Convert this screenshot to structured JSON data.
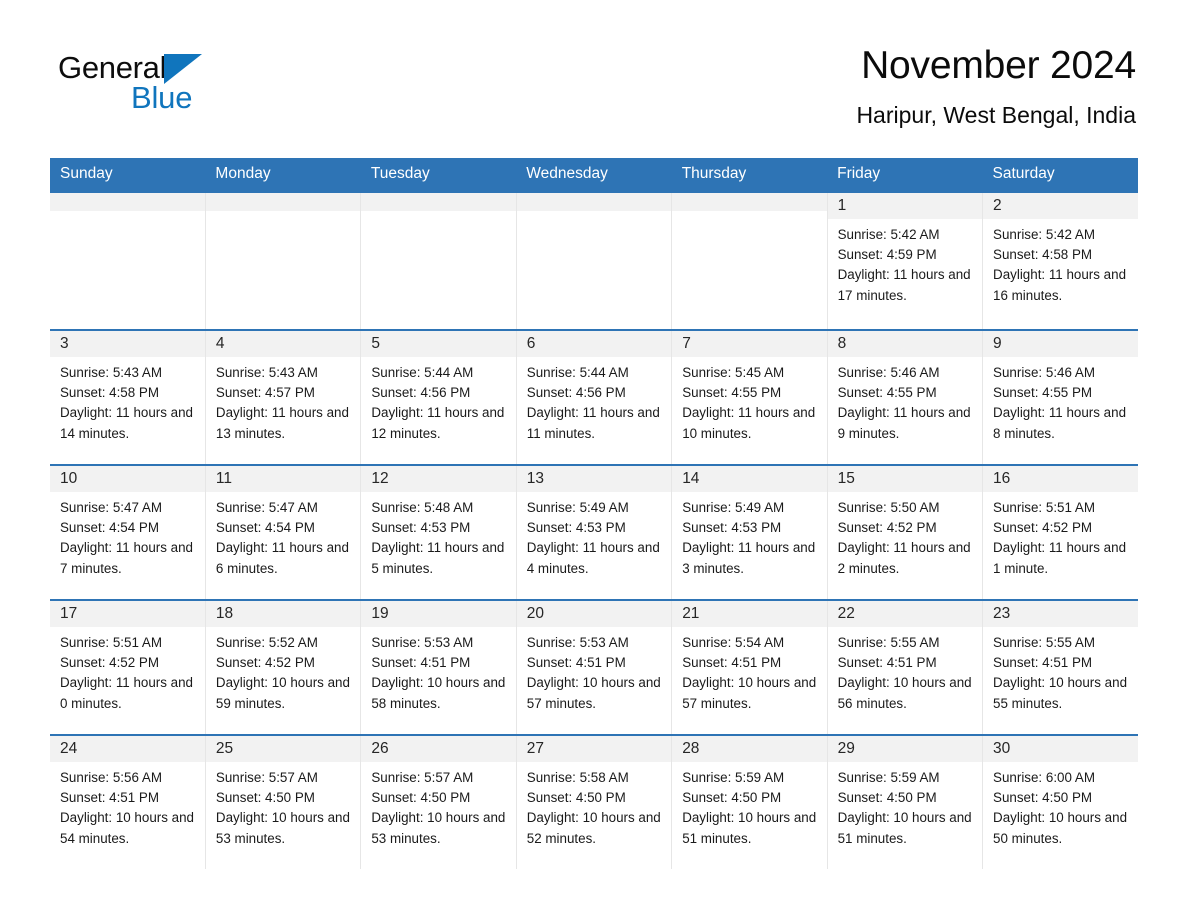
{
  "brand": {
    "word_one": "General",
    "word_two": "Blue",
    "triangle_color": "#1075bd",
    "icon": "triangle-logo-icon"
  },
  "header": {
    "title": "November 2024",
    "subtitle": "Haripur, West Bengal, India"
  },
  "theme": {
    "header_bar": "#2e74b5",
    "row_border": "#2e74b5",
    "daynum_bg": "#f2f2f2",
    "page_bg": "#ffffff",
    "text": "#1a1a1a"
  },
  "weekday_headers": [
    "Sunday",
    "Monday",
    "Tuesday",
    "Wednesday",
    "Thursday",
    "Friday",
    "Saturday"
  ],
  "labels": {
    "sunrise": "Sunrise:",
    "sunset": "Sunset:",
    "daylight": "Daylight:"
  },
  "weeks": [
    [
      {
        "day": "",
        "empty": true
      },
      {
        "day": "",
        "empty": true
      },
      {
        "day": "",
        "empty": true
      },
      {
        "day": "",
        "empty": true
      },
      {
        "day": "",
        "empty": true
      },
      {
        "day": "1",
        "sunrise": "Sunrise: 5:42 AM",
        "sunset": "Sunset: 4:59 PM",
        "daylight": "Daylight: 11 hours and 17 minutes."
      },
      {
        "day": "2",
        "sunrise": "Sunrise: 5:42 AM",
        "sunset": "Sunset: 4:58 PM",
        "daylight": "Daylight: 11 hours and 16 minutes."
      }
    ],
    [
      {
        "day": "3",
        "sunrise": "Sunrise: 5:43 AM",
        "sunset": "Sunset: 4:58 PM",
        "daylight": "Daylight: 11 hours and 14 minutes."
      },
      {
        "day": "4",
        "sunrise": "Sunrise: 5:43 AM",
        "sunset": "Sunset: 4:57 PM",
        "daylight": "Daylight: 11 hours and 13 minutes."
      },
      {
        "day": "5",
        "sunrise": "Sunrise: 5:44 AM",
        "sunset": "Sunset: 4:56 PM",
        "daylight": "Daylight: 11 hours and 12 minutes."
      },
      {
        "day": "6",
        "sunrise": "Sunrise: 5:44 AM",
        "sunset": "Sunset: 4:56 PM",
        "daylight": "Daylight: 11 hours and 11 minutes."
      },
      {
        "day": "7",
        "sunrise": "Sunrise: 5:45 AM",
        "sunset": "Sunset: 4:55 PM",
        "daylight": "Daylight: 11 hours and 10 minutes."
      },
      {
        "day": "8",
        "sunrise": "Sunrise: 5:46 AM",
        "sunset": "Sunset: 4:55 PM",
        "daylight": "Daylight: 11 hours and 9 minutes."
      },
      {
        "day": "9",
        "sunrise": "Sunrise: 5:46 AM",
        "sunset": "Sunset: 4:55 PM",
        "daylight": "Daylight: 11 hours and 8 minutes."
      }
    ],
    [
      {
        "day": "10",
        "sunrise": "Sunrise: 5:47 AM",
        "sunset": "Sunset: 4:54 PM",
        "daylight": "Daylight: 11 hours and 7 minutes."
      },
      {
        "day": "11",
        "sunrise": "Sunrise: 5:47 AM",
        "sunset": "Sunset: 4:54 PM",
        "daylight": "Daylight: 11 hours and 6 minutes."
      },
      {
        "day": "12",
        "sunrise": "Sunrise: 5:48 AM",
        "sunset": "Sunset: 4:53 PM",
        "daylight": "Daylight: 11 hours and 5 minutes."
      },
      {
        "day": "13",
        "sunrise": "Sunrise: 5:49 AM",
        "sunset": "Sunset: 4:53 PM",
        "daylight": "Daylight: 11 hours and 4 minutes."
      },
      {
        "day": "14",
        "sunrise": "Sunrise: 5:49 AM",
        "sunset": "Sunset: 4:53 PM",
        "daylight": "Daylight: 11 hours and 3 minutes."
      },
      {
        "day": "15",
        "sunrise": "Sunrise: 5:50 AM",
        "sunset": "Sunset: 4:52 PM",
        "daylight": "Daylight: 11 hours and 2 minutes."
      },
      {
        "day": "16",
        "sunrise": "Sunrise: 5:51 AM",
        "sunset": "Sunset: 4:52 PM",
        "daylight": "Daylight: 11 hours and 1 minute."
      }
    ],
    [
      {
        "day": "17",
        "sunrise": "Sunrise: 5:51 AM",
        "sunset": "Sunset: 4:52 PM",
        "daylight": "Daylight: 11 hours and 0 minutes."
      },
      {
        "day": "18",
        "sunrise": "Sunrise: 5:52 AM",
        "sunset": "Sunset: 4:52 PM",
        "daylight": "Daylight: 10 hours and 59 minutes."
      },
      {
        "day": "19",
        "sunrise": "Sunrise: 5:53 AM",
        "sunset": "Sunset: 4:51 PM",
        "daylight": "Daylight: 10 hours and 58 minutes."
      },
      {
        "day": "20",
        "sunrise": "Sunrise: 5:53 AM",
        "sunset": "Sunset: 4:51 PM",
        "daylight": "Daylight: 10 hours and 57 minutes."
      },
      {
        "day": "21",
        "sunrise": "Sunrise: 5:54 AM",
        "sunset": "Sunset: 4:51 PM",
        "daylight": "Daylight: 10 hours and 57 minutes."
      },
      {
        "day": "22",
        "sunrise": "Sunrise: 5:55 AM",
        "sunset": "Sunset: 4:51 PM",
        "daylight": "Daylight: 10 hours and 56 minutes."
      },
      {
        "day": "23",
        "sunrise": "Sunrise: 5:55 AM",
        "sunset": "Sunset: 4:51 PM",
        "daylight": "Daylight: 10 hours and 55 minutes."
      }
    ],
    [
      {
        "day": "24",
        "sunrise": "Sunrise: 5:56 AM",
        "sunset": "Sunset: 4:51 PM",
        "daylight": "Daylight: 10 hours and 54 minutes."
      },
      {
        "day": "25",
        "sunrise": "Sunrise: 5:57 AM",
        "sunset": "Sunset: 4:50 PM",
        "daylight": "Daylight: 10 hours and 53 minutes."
      },
      {
        "day": "26",
        "sunrise": "Sunrise: 5:57 AM",
        "sunset": "Sunset: 4:50 PM",
        "daylight": "Daylight: 10 hours and 53 minutes."
      },
      {
        "day": "27",
        "sunrise": "Sunrise: 5:58 AM",
        "sunset": "Sunset: 4:50 PM",
        "daylight": "Daylight: 10 hours and 52 minutes."
      },
      {
        "day": "28",
        "sunrise": "Sunrise: 5:59 AM",
        "sunset": "Sunset: 4:50 PM",
        "daylight": "Daylight: 10 hours and 51 minutes."
      },
      {
        "day": "29",
        "sunrise": "Sunrise: 5:59 AM",
        "sunset": "Sunset: 4:50 PM",
        "daylight": "Daylight: 10 hours and 51 minutes."
      },
      {
        "day": "30",
        "sunrise": "Sunrise: 6:00 AM",
        "sunset": "Sunset: 4:50 PM",
        "daylight": "Daylight: 10 hours and 50 minutes."
      }
    ]
  ]
}
